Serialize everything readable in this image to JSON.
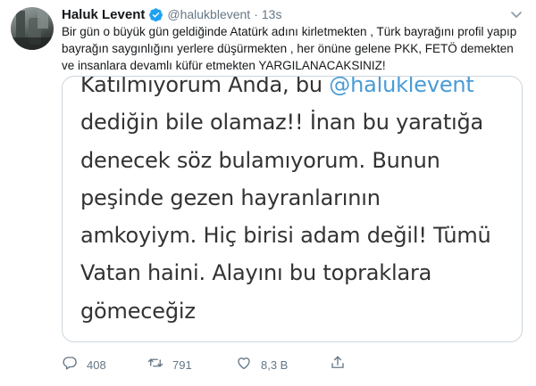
{
  "tweet": {
    "author": {
      "name": "Haluk Levent",
      "handle": "@halukblevent",
      "verified": true
    },
    "separator": "·",
    "time": "13s",
    "text": "Bir gün o büyük gün geldiğinde Atatürk adını kirletmekten , Türk bayrağını profil yapıp bayrağın saygınlığını yerlere düşürmekten , her önüne gelene PKK, FETÖ demekten ve insanlara devamlı küfür etmekten YARGILANACAKSINIZ!",
    "media": {
      "lines": [
        {
          "pre": "Katılmıyorum Anda, bu ",
          "mention": "@haluklevent"
        },
        {
          "pre": "dediğin bile olamaz!! İnan bu yaratığa",
          "mention": ""
        },
        {
          "pre": "denecek söz bulamıyorum. Bunun",
          "mention": ""
        },
        {
          "pre": "peşinde gezen hayranlarının",
          "mention": ""
        },
        {
          "pre": "amkoyiym. Hiç birisi adam değil! Tümü",
          "mention": ""
        },
        {
          "pre": "Vatan haini. Alayını bu topraklara",
          "mention": ""
        },
        {
          "pre": "gömeceğiz",
          "mention": ""
        }
      ]
    },
    "actions": {
      "reply_count": "408",
      "retweet_count": "791",
      "like_count": "8,3 B"
    },
    "colors": {
      "verified_badge": "#1da1f2",
      "mention": "#4a9bd6",
      "secondary_text": "#657786"
    },
    "icons": {
      "verified": "verified-badge-icon",
      "caret": "chevron-down-icon",
      "reply": "reply-icon",
      "retweet": "retweet-icon",
      "like": "heart-icon",
      "share": "share-icon"
    }
  }
}
